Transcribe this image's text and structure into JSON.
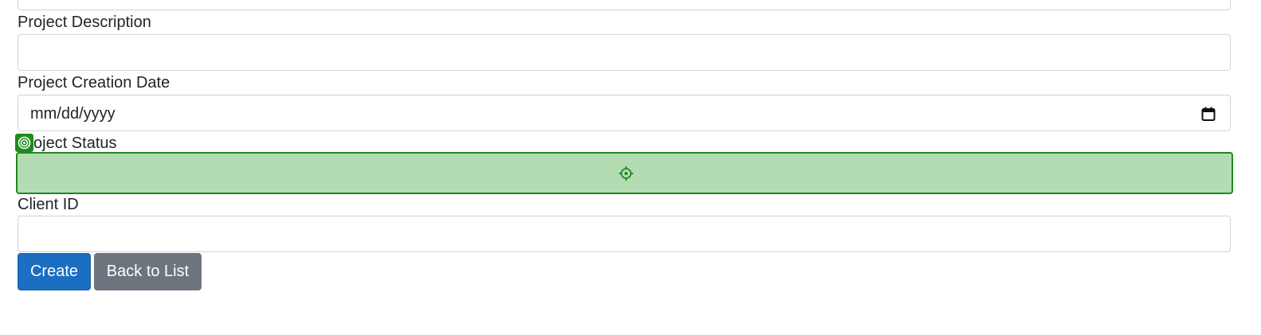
{
  "form": {
    "top_input": {
      "value": ""
    },
    "project_description": {
      "label": "Project Description",
      "value": ""
    },
    "project_creation_date": {
      "label": "Project Creation Date",
      "placeholder": "mm/dd/yyyy",
      "icon": "calendar-icon"
    },
    "project_status": {
      "label": "oject Status",
      "value": "",
      "highlight_color": "#b3dcb3",
      "border_color": "#1e8a1e",
      "icons": [
        "badge-target-icon",
        "crosshair-icon"
      ]
    },
    "client_id": {
      "label": "Client ID",
      "value": ""
    }
  },
  "buttons": {
    "create_label": "Create",
    "back_label": "Back to List"
  },
  "colors": {
    "primary": "#1b6ec2",
    "secondary": "#6c757d",
    "highlight": "#b3dcb3",
    "highlight_border": "#1e8a1e"
  }
}
